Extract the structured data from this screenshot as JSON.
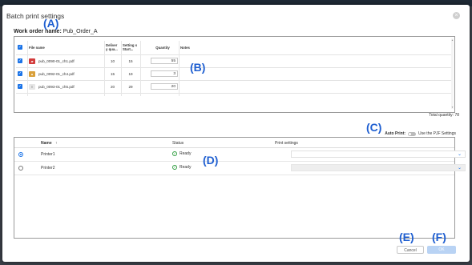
{
  "dialog": {
    "title": "Batch print settings",
    "close_glyph": "×",
    "work_order_label": "Work order name:",
    "work_order_value": "Pub_Order_A"
  },
  "callouts": {
    "a": "(A)",
    "b": "(B)",
    "c": "(C)",
    "d": "(D)",
    "e": "(E)",
    "f": "(F)"
  },
  "files": {
    "headers": {
      "file_name": "File name",
      "delivery": "Deliver y qua...",
      "setting": "Setting s Start...",
      "quantity": "Quantity",
      "notes": "Notes"
    },
    "rows": [
      {
        "name": "pub_0090-01_ch1.pdf",
        "delivery": "10",
        "setting": "15",
        "quantity": "55",
        "thumb_color": "#d23b3b",
        "thumb_glyph": "▰"
      },
      {
        "name": "pub_0092-01_ch4.pdf",
        "delivery": "15",
        "setting": "19",
        "quantity": "3",
        "thumb_color": "#d9a03a",
        "thumb_glyph": "▲"
      },
      {
        "name": "pub_0093-01_ch5.pdf",
        "delivery": "20",
        "setting": "29",
        "quantity": "20",
        "thumb_color": "#e6e6e6",
        "thumb_glyph": "≡"
      }
    ],
    "total_label": "Total quantity:",
    "total_value": "78"
  },
  "auto_print": {
    "label": "Auto Print:",
    "toggle_text": "Use the PJF Settings"
  },
  "printers": {
    "headers": {
      "name": "Name",
      "sort_glyph": "↑",
      "status": "Status",
      "print_settings": "Print settings"
    },
    "rows": [
      {
        "name": "Printer1",
        "status": "Ready",
        "selected": true
      },
      {
        "name": "Printer2",
        "status": "Ready",
        "selected": false
      }
    ]
  },
  "buttons": {
    "cancel": "Cancel",
    "ok": "OK"
  },
  "colors": {
    "accent": "#1a73e8",
    "callout": "#1f5fd1",
    "ready": "#2e9d3f",
    "ok_disabled": "#b9d3f4"
  },
  "icons": {
    "check": "✓",
    "chevron": "⌄"
  }
}
